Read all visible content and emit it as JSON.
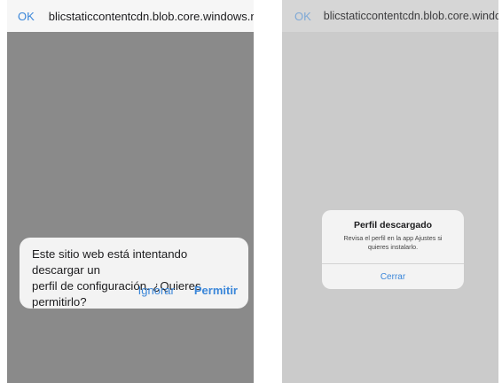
{
  "left_screen": {
    "url_bar": {
      "ok_label": "OK",
      "host": "blicstaticcontentcdn.blob.core.windows.net"
    },
    "alert": {
      "message_line1": "Este sitio web está intentando descargar un",
      "message_line2": "perfil de configuración. ¿Quieres permitirlo?",
      "ignore_label": "Ignorar",
      "allow_label": "Permitir"
    }
  },
  "right_screen": {
    "url_bar": {
      "ok_label": "OK",
      "host": "blicstaticcontentcdn.blob.core.windows.net"
    },
    "alert": {
      "title": "Perfil descargado",
      "subtitle_line1": "Revisa el perfil en la app Ajustes si",
      "subtitle_line2": "quieres instalarlo.",
      "close_label": "Cerrar"
    }
  },
  "colors": {
    "accent": "#3a86d9",
    "dim_overlay_left": "#8a8a8a",
    "dim_overlay_right": "#cbcbcb",
    "alert_bg": "#f3f3f3"
  }
}
